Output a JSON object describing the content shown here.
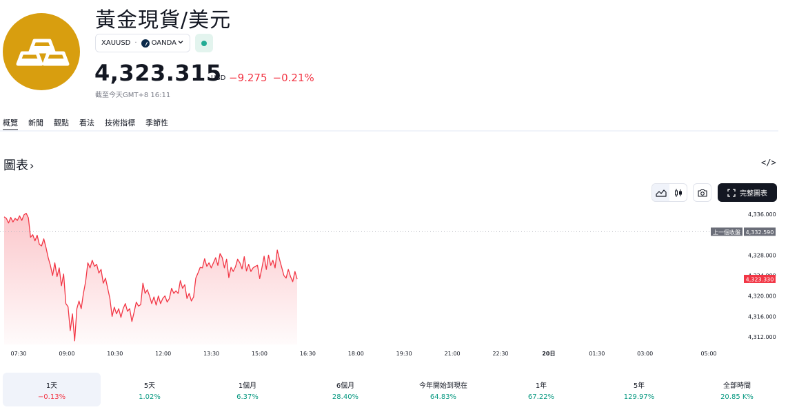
{
  "header": {
    "title": "黃金現貨/美元",
    "symbol": "XAUUSD",
    "separator": "·",
    "broker": "OANDA",
    "price": "4,323.315",
    "currency": "USD",
    "change_abs": "−9.275",
    "change_pct": "−0.21%",
    "as_of": "截至今天GMT+8 16:11"
  },
  "colors": {
    "gold": "#d89e0f",
    "down": "#f23645",
    "up": "#089981",
    "status": "#22ab94"
  },
  "tabs": [
    {
      "label": "概覽",
      "active": true
    },
    {
      "label": "新聞"
    },
    {
      "label": "觀點"
    },
    {
      "label": "看法"
    },
    {
      "label": "技術指標"
    },
    {
      "label": "季節性"
    }
  ],
  "section": {
    "title": "圖表",
    "arrow": "›",
    "embed": "</>"
  },
  "toolbar": {
    "full_chart": "完整圖表"
  },
  "chart_data": {
    "type": "area",
    "x_ticks": [
      "07:30",
      "09:00",
      "10:30",
      "12:00",
      "13:30",
      "15:00",
      "16:30",
      "18:00",
      "19:30",
      "21:00",
      "22:30",
      "20日",
      "01:30",
      "03:00",
      "05:00"
    ],
    "y_ticks": [
      "4,336.000",
      "4,328.000",
      "4,324.000",
      "4,320.000",
      "4,316.000",
      "4,312.000"
    ],
    "y_tick_values": [
      4336,
      4328,
      4324,
      4320,
      4316,
      4312
    ],
    "ylim": [
      4310.5,
      4337.5
    ],
    "prev_close": {
      "label": "上一個收盤",
      "value": 4332.59,
      "display": "4,332.590"
    },
    "last": {
      "value": 4323.33,
      "display": "4,323.330"
    },
    "series": [
      {
        "values": [
          4335.5,
          4335.2,
          4334.3,
          4335.4,
          4334.5,
          4335.2,
          4334.8,
          4335.7,
          4334.8,
          4335.9,
          4336.2,
          4335.3,
          4331.5,
          4332.0,
          4330.8,
          4331.9,
          4330.1,
          4329.8,
          4331.2,
          4329.5,
          4327.5,
          4326.0,
          4324.0,
          4326.5,
          4323.8,
          4325.5,
          4322.0,
          4324.3,
          4318.5,
          4317.9,
          4313.2,
          4316.5,
          4311.2,
          4317.5,
          4319.0,
          4317.5,
          4320.5,
          4322.8,
          4326.5,
          4325.5,
          4327.0,
          4325.8,
          4326.2,
          4324.5,
          4325.2,
          4322.5,
          4323.5,
          4321.5,
          4319.5,
          4316.0,
          4317.8,
          4316.5,
          4317.5,
          4315.8,
          4317.5,
          4318.5,
          4317.0,
          4317.5,
          4315.0,
          4316.8,
          4318.8,
          4318.0,
          4318.3,
          4322.5,
          4320.5,
          4321.2,
          4320.0,
          4318.5,
          4319.8,
          4318.2,
          4320.0,
          4318.5,
          4319.5,
          4320.0,
          4318.8,
          4319.5,
          4321.5,
          4320.5,
          4321.0,
          4320.5,
          4323.0,
          4321.5,
          4322.2,
          4319.5,
          4320.5,
          4319.0,
          4319.8,
          4323.5,
          4324.5,
          4325.6,
          4325.5,
          4327.3,
          4325.8,
          4326.5,
          4325.5,
          4326.5,
          4327.5,
          4326.0,
          4328.3,
          4327.5,
          4325.5,
          4327.2,
          4323.6,
          4325.6,
          4324.8,
          4325.7,
          4327.2,
          4326.5,
          4325.3,
          4327.7,
          4324.9,
          4326.2,
          4324.8,
          4325.5,
          4325.8,
          4326.0,
          4323.4,
          4325.5,
          4327.8,
          4325.2,
          4328.0,
          4326.0,
          4327.0,
          4325.5,
          4329.0,
          4327.2,
          4325.6,
          4324.0,
          4323.5,
          4325.2,
          4323.8,
          4322.8,
          4324.8,
          4323.3
        ]
      }
    ]
  },
  "periods": [
    {
      "label": "1天",
      "value": "−0.13%",
      "dir": "down",
      "active": true
    },
    {
      "label": "5天",
      "value": "1.02%",
      "dir": "up"
    },
    {
      "label": "1個月",
      "value": "6.37%",
      "dir": "up"
    },
    {
      "label": "6個月",
      "value": "28.40%",
      "dir": "up"
    },
    {
      "label": "今年開始到現在",
      "value": "64.83%",
      "dir": "up"
    },
    {
      "label": "1年",
      "value": "67.22%",
      "dir": "up"
    },
    {
      "label": "5年",
      "value": "129.97%",
      "dir": "up"
    },
    {
      "label": "全部時間",
      "value": "20.85 K%",
      "dir": "up"
    }
  ]
}
